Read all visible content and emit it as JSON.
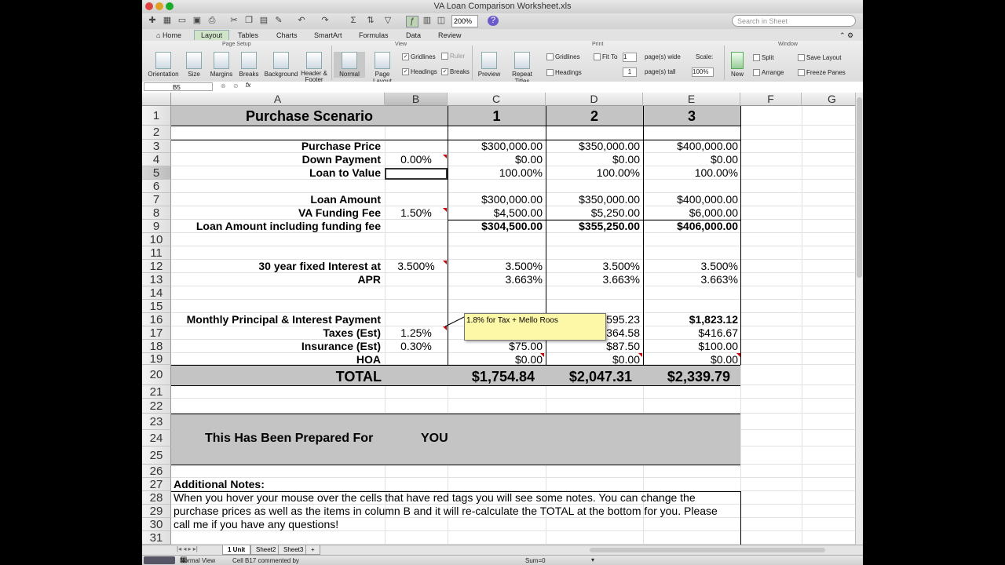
{
  "window": {
    "title": "VA Loan Comparison Worksheet.xls"
  },
  "toolbar": {
    "zoom": "200%",
    "search_placeholder": "Search in Sheet"
  },
  "ribbon": {
    "tabs": [
      "Home",
      "Layout",
      "Tables",
      "Charts",
      "SmartArt",
      "Formulas",
      "Data",
      "Review"
    ],
    "active_tab": "Layout",
    "groups": {
      "page_setup": "Page Setup",
      "view": "View",
      "print": "Print",
      "window": "Window"
    },
    "page_setup_buttons": [
      "Orientation",
      "Size",
      "Margins",
      "Breaks",
      "Background",
      "Header & Footer"
    ],
    "view_buttons": [
      "Normal",
      "Page Layout"
    ],
    "view_checks": {
      "gridlines": "Gridlines",
      "ruler": "Ruler",
      "headings": "Headings",
      "breaks": "Breaks"
    },
    "print_buttons": [
      "Preview",
      "Repeat Titles"
    ],
    "print_checks": {
      "gridlines": "Gridlines",
      "headings": "Headings"
    },
    "fit_to": {
      "label": "Fit To",
      "wide_value": "1",
      "wide_label": "page(s) wide",
      "tall_value": "1",
      "tall_label": "page(s) tall"
    },
    "scale": {
      "label": "Scale:",
      "value": "100%"
    },
    "window_buttons": {
      "new": "New",
      "split": "Split",
      "arrange": "Arrange",
      "save_layout": "Save Layout",
      "freeze": "Freeze Panes"
    }
  },
  "formula_bar": {
    "name_box": "B5",
    "fx": "fx"
  },
  "columns": [
    "A",
    "B",
    "C",
    "D",
    "E",
    "F",
    "G"
  ],
  "rows": [
    "1",
    "2",
    "3",
    "4",
    "5",
    "6",
    "7",
    "8",
    "9",
    "10",
    "11",
    "12",
    "13",
    "14",
    "15",
    "16",
    "17",
    "18",
    "19",
    "20",
    "21",
    "22",
    "23",
    "24",
    "25",
    "26",
    "27",
    "28",
    "29",
    "30",
    "31"
  ],
  "sheet": {
    "r1": {
      "a": "Purchase Scenario",
      "c": "1",
      "d": "2",
      "e": "3"
    },
    "r3": {
      "a": "Purchase Price",
      "c": "$300,000.00",
      "d": "$350,000.00",
      "e": "$400,000.00"
    },
    "r4": {
      "a": "Down Payment",
      "b": "0.00%",
      "c": "$0.00",
      "d": "$0.00",
      "e": "$0.00"
    },
    "r5": {
      "a": "Loan to Value",
      "c": "100.00%",
      "d": "100.00%",
      "e": "100.00%"
    },
    "r7": {
      "a": "Loan Amount",
      "c": "$300,000.00",
      "d": "$350,000.00",
      "e": "$400,000.00"
    },
    "r8": {
      "a": "VA Funding Fee",
      "b": "1.50%",
      "c": "$4,500.00",
      "d": "$5,250.00",
      "e": "$6,000.00"
    },
    "r9": {
      "a": "Loan Amount including funding fee",
      "c": "$304,500.00",
      "d": "$355,250.00",
      "e": "$406,000.00"
    },
    "r12": {
      "a": "30 year fixed Interest at",
      "b": "3.500%",
      "c": "3.500%",
      "d": "3.500%",
      "e": "3.500%"
    },
    "r13": {
      "a": "APR",
      "c": "3.663%",
      "d": "3.663%",
      "e": "3.663%"
    },
    "r16": {
      "a": "Monthly Principal & Interest Payment",
      "d": "595.23",
      "e": "$1,823.12"
    },
    "r17": {
      "a": "Taxes (Est)",
      "b": "1.25%",
      "d": "364.58",
      "e": "$416.67"
    },
    "r18": {
      "a": "Insurance (Est)",
      "b": "0.30%",
      "c": "$75.00",
      "d": "$87.50",
      "e": "$100.00"
    },
    "r19": {
      "a": "HOA",
      "c": "$0.00",
      "d": "$0.00",
      "e": "$0.00"
    },
    "r20": {
      "a": "TOTAL",
      "c": "$1,754.84",
      "d": "$2,047.31",
      "e": "$2,339.79"
    },
    "r24": {
      "a": "This Has Been Prepared For",
      "b": "YOU"
    },
    "r27": {
      "a": "Additional Notes:"
    },
    "r28": {
      "a": "When you hover your mouse over the cells that have red tags you will see some notes.  You can change the"
    },
    "r29": {
      "a": "purchase prices as well as the items in column B and it will re-calculate the TOTAL at the bottom for you.  Please"
    },
    "r30": {
      "a": "call me if you have any questions!"
    }
  },
  "comment": {
    "text": "1.8% for Tax + Mello Roos"
  },
  "sheet_tabs": [
    "1 Unit",
    "Sheet2",
    "Sheet3"
  ],
  "status": {
    "view": "Normal View",
    "message": "Cell B17 commented by",
    "sum": "Sum=0"
  }
}
